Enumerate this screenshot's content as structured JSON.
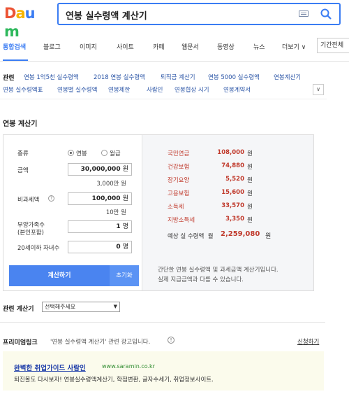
{
  "header": {
    "logo_letters": [
      "D",
      "a",
      "u",
      "m"
    ],
    "logo_colors": [
      "#ec5435",
      "#f5b400",
      "#3a7cf3",
      "#2eb85c"
    ],
    "search_value": "연봉 실수령액 계산기"
  },
  "tabs": {
    "items": [
      "통합검색",
      "블로그",
      "이미지",
      "사이트",
      "카페",
      "웹문서",
      "동영상",
      "뉴스",
      "더보기 ∨"
    ],
    "period": "기간전체"
  },
  "related": {
    "title": "관련",
    "items": [
      "연봉 1억5천 실수령액",
      "2018 연봉 실수령액",
      "퇴직금 계산기",
      "연봉 5000 실수령액",
      "연봉계산기",
      "연봉 실수령액표",
      "연봉별 실수령액",
      "연봉제한",
      "사람인",
      "연봉협상 시기",
      "연봉계약서"
    ],
    "more": "∨"
  },
  "calculator": {
    "title": "연봉 계산기",
    "type_label": "종류",
    "type_options": [
      "연봉",
      "월급"
    ],
    "amount_label": "금액",
    "amount_value": "30,000,000",
    "amount_unit": "원",
    "amount_hint": "3,000만 원",
    "nontax_label": "비과세액",
    "nontax_value": "100,000",
    "nontax_unit": "원",
    "nontax_hint": "10만 원",
    "dependents_label_1": "부양가족수",
    "dependents_label_2": "(본인포함)",
    "dependents_value": "1",
    "dependents_unit": "명",
    "children_label": "20세이하 자녀수",
    "children_value": "0",
    "children_unit": "명",
    "calc_button": "계산하기",
    "reset_button": "초기화",
    "results": [
      {
        "label": "국민연금",
        "value": "108,000"
      },
      {
        "label": "건강보험",
        "value": "74,880"
      },
      {
        "label": "장기요양",
        "value": "5,520"
      },
      {
        "label": "고용보험",
        "value": "15,600"
      },
      {
        "label": "소득세",
        "value": "33,570"
      },
      {
        "label": "지방소득세",
        "value": "3,350"
      }
    ],
    "result_unit": "원",
    "net_label": "예상 실 수령액",
    "net_prefix": "월",
    "net_value": "2,259,080",
    "net_unit": "원",
    "note_1": "간단한 연봉 실수령액 및 과세금액 계산기입니다.",
    "note_2": "실제 지급금액과 다를 수 있습니다."
  },
  "related_calc": {
    "title": "관련 계산기",
    "select_value": "선택해주세요"
  },
  "premium": {
    "title": "프리미엄링크",
    "desc": "'연봉 실수령액 계산기' 관련 광고입니다.",
    "info": "!",
    "apply": "신청하기",
    "ad_title": "완벽한 취업가이드 사람인",
    "ad_url": "www.saramin.co.kr",
    "ad_desc": "퇴진볼도 다시보자! 연봉실수령액계산기, 학점변환, 글자수세기, 취업정보사이트."
  }
}
